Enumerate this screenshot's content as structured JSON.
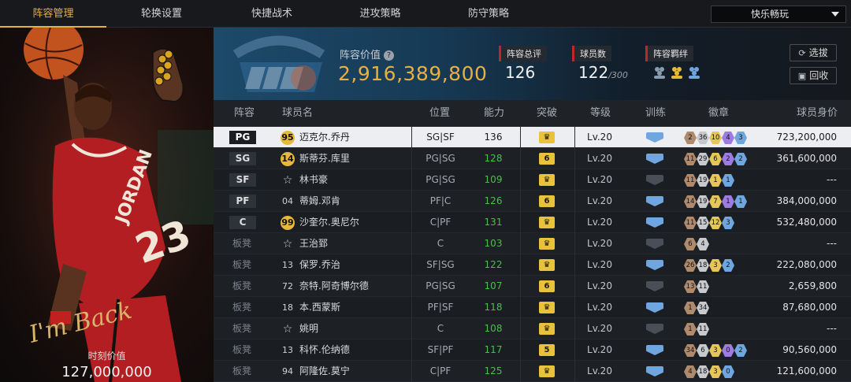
{
  "nav": {
    "tabs": [
      "阵容管理",
      "轮换设置",
      "快捷战术",
      "进攻策略",
      "防守策略"
    ],
    "mode_select": "快乐畅玩"
  },
  "left_panel": {
    "signature": "I'm Back",
    "moment_label": "时刻价值",
    "moment_value": "127,000,000"
  },
  "team_header": {
    "value_label": "阵容价值",
    "value": "2,916,389,800",
    "overall_label": "阵容总评",
    "overall": "126",
    "count_label": "球员数",
    "count": "122",
    "count_max": "/300",
    "bond_label": "阵容羁绊",
    "btn_pick": "选拔",
    "btn_recycle": "回收"
  },
  "table": {
    "headers": {
      "lineup": "阵容",
      "name": "球员名",
      "position": "位置",
      "ability": "能力",
      "breakthrough": "突破",
      "level": "等级",
      "training": "训练",
      "badges": "徽章",
      "price": "球员身价"
    },
    "rows": [
      {
        "slot": "PG",
        "num": "95",
        "name": "迈克尔.乔丹",
        "pos": "SG|SF",
        "ability": "136",
        "break": "crown",
        "level": "Lv.20",
        "train": "blue",
        "badges": [
          [
            "2",
            "bronze"
          ],
          [
            "36",
            "silver"
          ],
          [
            "10",
            "gold"
          ],
          [
            "4",
            "purple"
          ],
          [
            "3",
            "blue"
          ]
        ],
        "price": "723,200,000"
      },
      {
        "slot": "SG",
        "num": "14",
        "name": "斯蒂芬.库里",
        "pos": "PG|SG",
        "ability": "128",
        "break": "6",
        "level": "Lv.20",
        "train": "blue",
        "badges": [
          [
            "11",
            "bronze"
          ],
          [
            "29",
            "silver"
          ],
          [
            "6",
            "gold"
          ],
          [
            "2",
            "purple"
          ],
          [
            "2",
            "blue"
          ]
        ],
        "price": "361,600,000"
      },
      {
        "slot": "SF",
        "num": "☆",
        "name": "林书豪",
        "pos": "PG|SG",
        "ability": "109",
        "break": "crown",
        "level": "Lv.20",
        "train": "gray",
        "badges": [
          [
            "11",
            "bronze"
          ],
          [
            "19",
            "silver"
          ],
          [
            "1",
            "gold"
          ],
          [
            "1",
            "blue"
          ]
        ],
        "price": "---"
      },
      {
        "slot": "PF",
        "num": "04",
        "name": "蒂姆.邓肯",
        "pos": "PF|C",
        "ability": "126",
        "break": "6",
        "level": "Lv.20",
        "train": "blue",
        "badges": [
          [
            "14",
            "bronze"
          ],
          [
            "19",
            "silver"
          ],
          [
            "7",
            "gold"
          ],
          [
            "1",
            "purple"
          ],
          [
            "1",
            "blue"
          ]
        ],
        "price": "384,000,000"
      },
      {
        "slot": "C",
        "num": "99",
        "name": "沙奎尔.奥尼尔",
        "pos": "C|PF",
        "ability": "131",
        "break": "crown",
        "level": "Lv.20",
        "train": "blue",
        "badges": [
          [
            "11",
            "bronze"
          ],
          [
            "15",
            "silver"
          ],
          [
            "12",
            "gold"
          ],
          [
            "3",
            "blue"
          ]
        ],
        "price": "532,480,000"
      },
      {
        "slot": "板凳",
        "num": "☆",
        "name": "王治郅",
        "pos": "C",
        "ability": "103",
        "break": "crown",
        "level": "Lv.20",
        "train": "gray",
        "badges": [
          [
            "6",
            "bronze"
          ],
          [
            "4",
            "silver"
          ]
        ],
        "price": "---"
      },
      {
        "slot": "板凳",
        "num": "13",
        "name": "保罗.乔治",
        "pos": "SF|SG",
        "ability": "122",
        "break": "crown",
        "level": "Lv.20",
        "train": "blue",
        "badges": [
          [
            "26",
            "bronze"
          ],
          [
            "18",
            "silver"
          ],
          [
            "3",
            "gold"
          ],
          [
            "2",
            "blue"
          ]
        ],
        "price": "222,080,000"
      },
      {
        "slot": "板凳",
        "num": "72",
        "name": "奈特.阿奇博尔德",
        "pos": "PG|SG",
        "ability": "107",
        "break": "6",
        "level": "Lv.20",
        "train": "gray",
        "badges": [
          [
            "13",
            "bronze"
          ],
          [
            "11",
            "silver"
          ]
        ],
        "price": "2,659,800"
      },
      {
        "slot": "板凳",
        "num": "18",
        "name": "本.西蒙斯",
        "pos": "PF|SF",
        "ability": "118",
        "break": "crown",
        "level": "Lv.20",
        "train": "blue",
        "badges": [
          [
            "1",
            "bronze"
          ],
          [
            "34",
            "silver"
          ]
        ],
        "price": "87,680,000"
      },
      {
        "slot": "板凳",
        "num": "☆",
        "name": "姚明",
        "pos": "C",
        "ability": "108",
        "break": "crown",
        "level": "Lv.20",
        "train": "gray",
        "badges": [
          [
            "1",
            "bronze"
          ],
          [
            "11",
            "silver"
          ]
        ],
        "price": "---"
      },
      {
        "slot": "板凳",
        "num": "13",
        "name": "科怀.伦纳德",
        "pos": "SF|PF",
        "ability": "117",
        "break": "5",
        "level": "Lv.20",
        "train": "blue",
        "badges": [
          [
            "34",
            "bronze"
          ],
          [
            "6",
            "silver"
          ],
          [
            "3",
            "gold"
          ],
          [
            "0",
            "purple"
          ],
          [
            "2",
            "blue"
          ]
        ],
        "price": "90,560,000"
      },
      {
        "slot": "板凳",
        "num": "94",
        "name": "阿隆佐.莫宁",
        "pos": "C|PF",
        "ability": "125",
        "break": "crown",
        "level": "Lv.20",
        "train": "blue",
        "badges": [
          [
            "4",
            "bronze"
          ],
          [
            "18",
            "silver"
          ],
          [
            "3",
            "gold"
          ],
          [
            "0",
            "blue"
          ]
        ],
        "price": "121,600,000"
      }
    ]
  },
  "colors": {
    "accent": "#e8b040",
    "ability_green": "#4bbf4b",
    "stat_red": "#c02828"
  }
}
